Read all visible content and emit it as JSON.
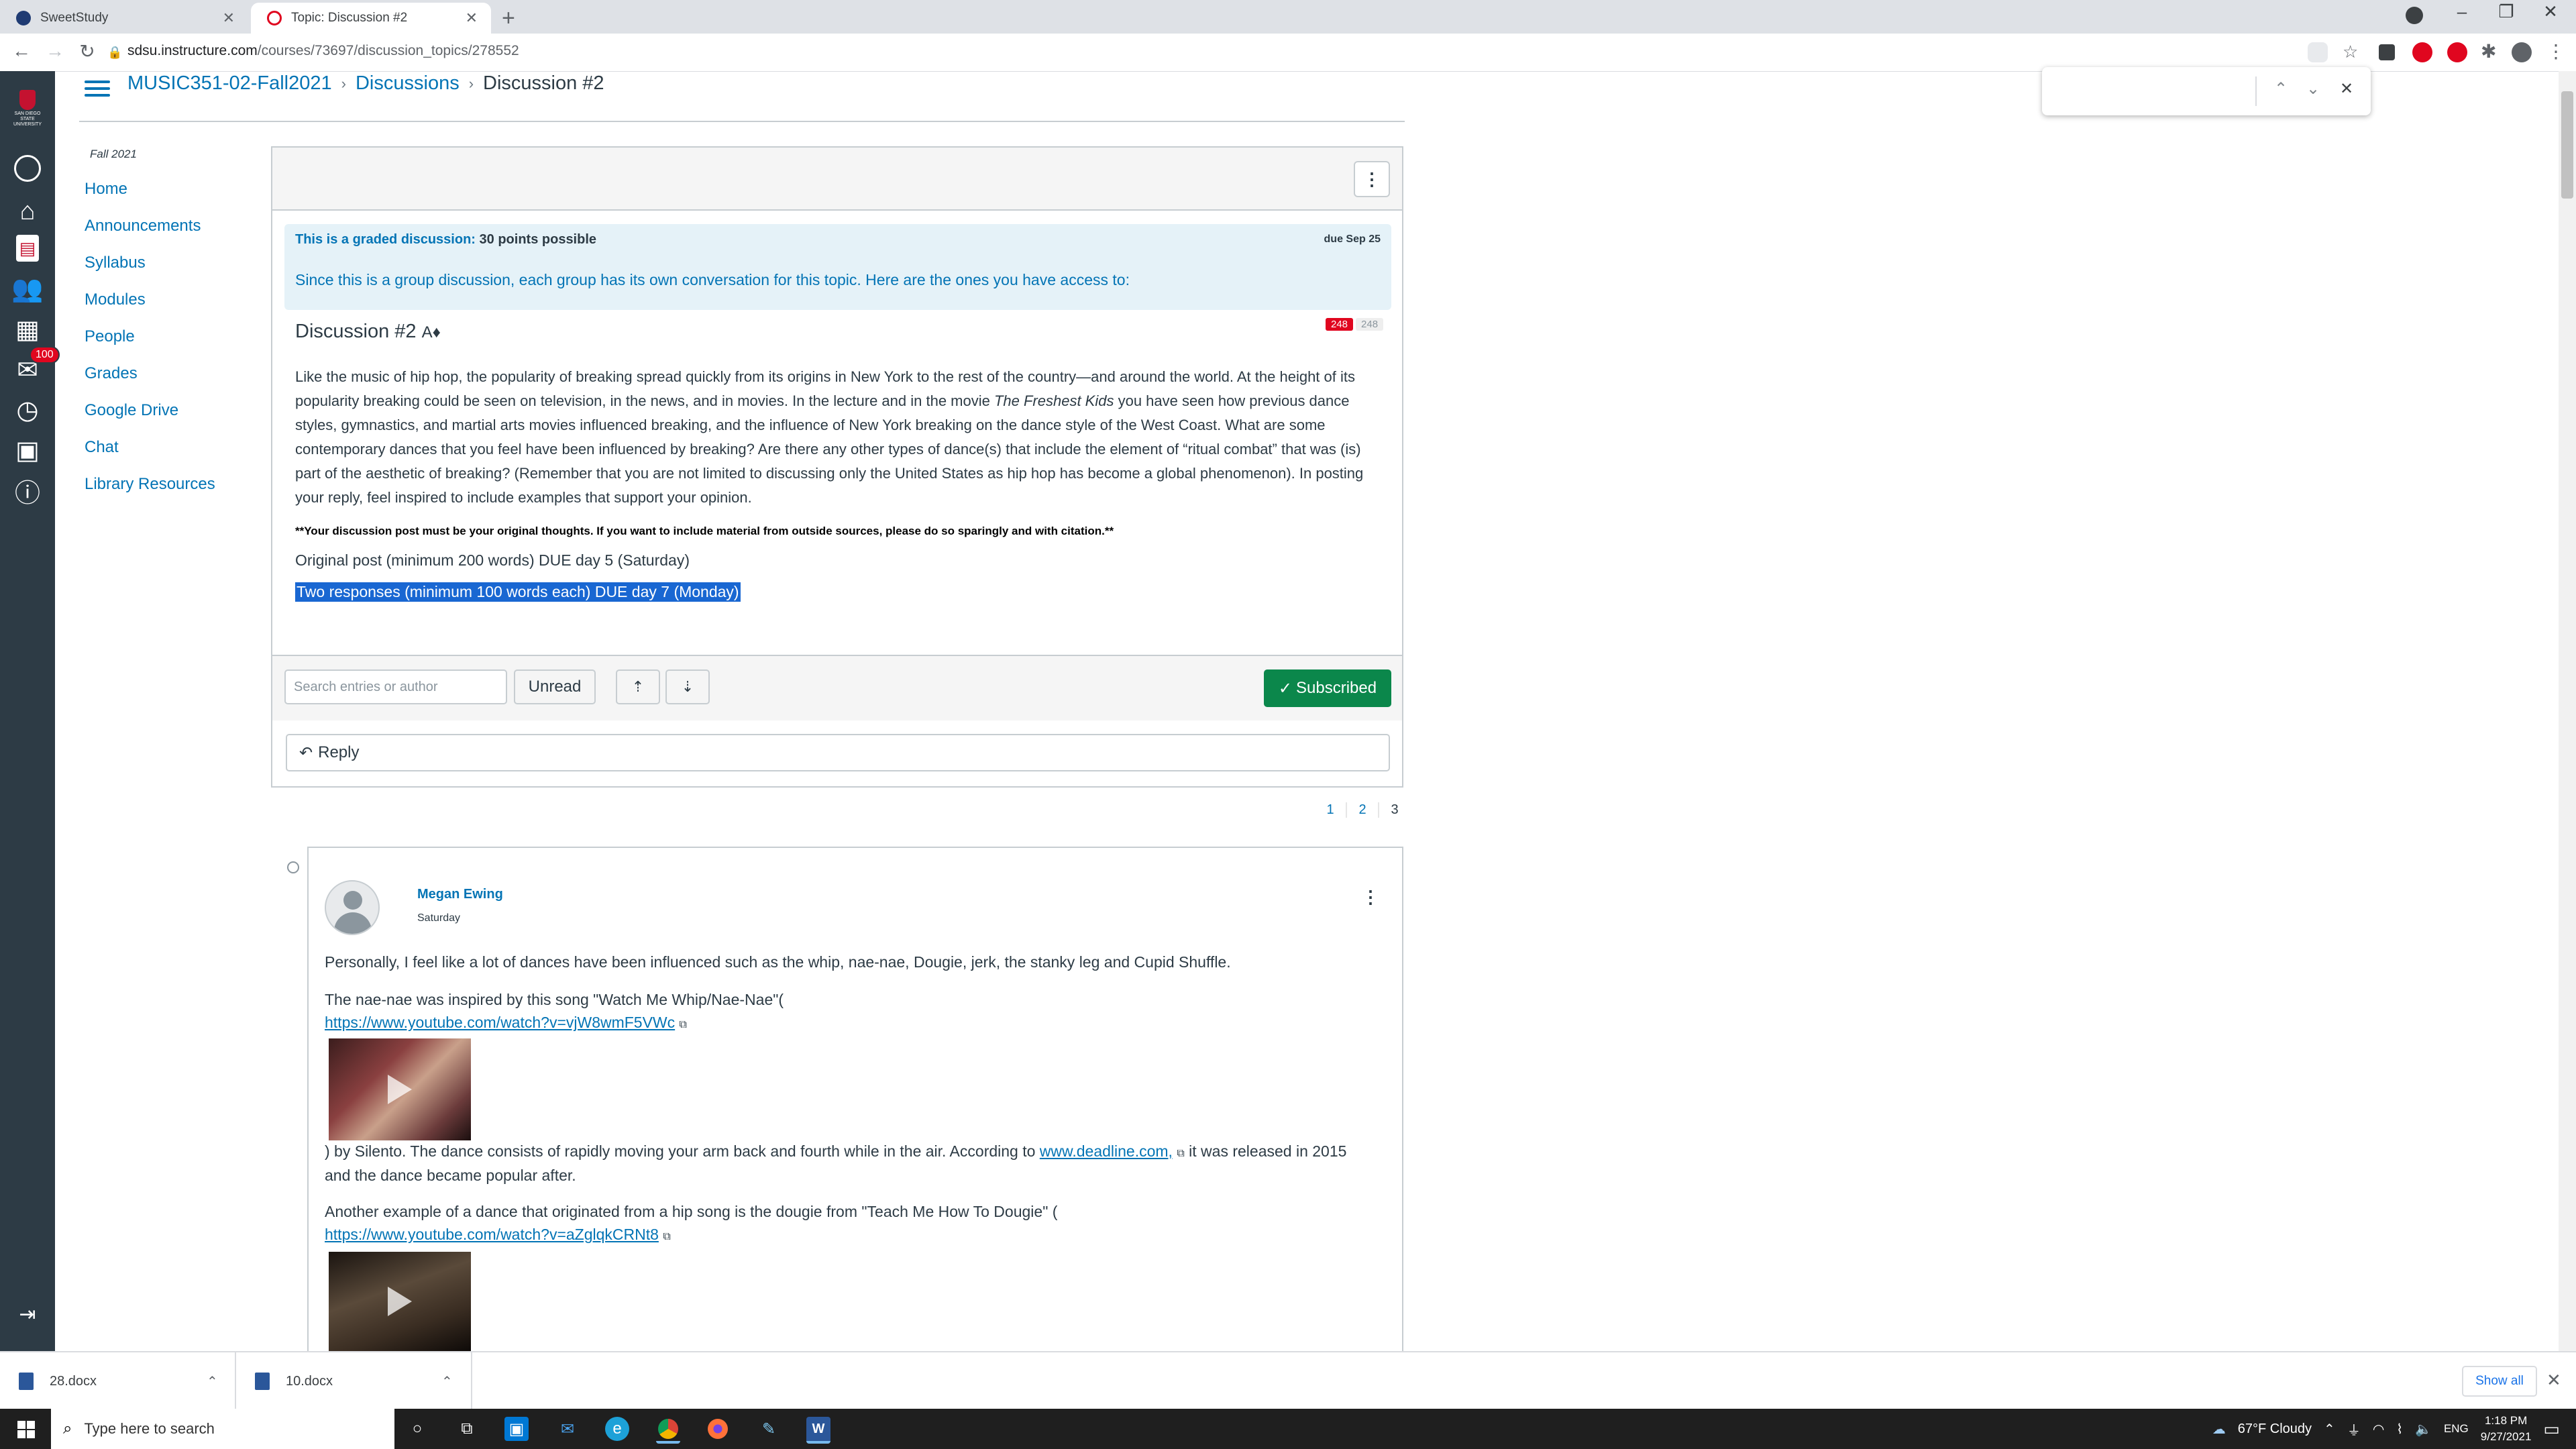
{
  "browser": {
    "tabs": [
      {
        "title": "SweetStudy",
        "active": false
      },
      {
        "title": "Topic: Discussion #2",
        "active": true
      }
    ],
    "url_host": "sdsu.instructure.com",
    "url_path": "/courses/73697/discussion_topics/278552"
  },
  "global_nav": {
    "institution": "SAN DIEGO STATE UNIVERSITY",
    "inbox_badge": "100"
  },
  "breadcrumb": {
    "course": "MUSIC351-02-Fall2021",
    "section": "Discussions",
    "current": "Discussion #2"
  },
  "course_nav": {
    "term": "Fall 2021",
    "items": [
      "Home",
      "Announcements",
      "Syllabus",
      "Modules",
      "People",
      "Grades",
      "Google Drive",
      "Chat",
      "Library Resources"
    ]
  },
  "discussion": {
    "graded_label": "This is a graded discussion:",
    "points": "30 points possible",
    "due": "due Sep 25",
    "group_message": "Since this is a group discussion, each group has its own conversation for this topic. Here are the ones you have access to:",
    "title": "Discussion #2",
    "unread_count": "248",
    "total_count": "248",
    "body_1": "Like the music of hip hop, the popularity of breaking spread quickly from its origins in New York to the rest of the country—and around the world. At the height of its popularity breaking could be seen on television, in the news, and in movies. In the lecture and in the movie ",
    "body_movie": "The Freshest Kids",
    "body_2": " you have seen how previous dance styles, gymnastics, and martial arts movies influenced breaking, and the influence of New York breaking on the dance style of the West Coast. What are some contemporary dances that you feel have been influenced by breaking? Are there any other types of dance(s) that include the element of “ritual combat” that was (is) part of the aesthetic of breaking? (Remember that you are not limited to discussing only the United States as hip hop has become a global phenomenon). In posting your reply, feel inspired to include examples that support your opinion.",
    "note": "**Your discussion post must be your original thoughts. If you want to include material from outside sources, please do so sparingly and with citation.**",
    "original_post": "Original post (minimum 200 words) DUE day 5 (Saturday)",
    "responses": "Two responses (minimum 100 words each) DUE day 7 (Monday)"
  },
  "toolbar": {
    "search_placeholder": "Search entries or author",
    "unread_label": "Unread",
    "subscribed_label": "Subscribed",
    "reply_label": "Reply"
  },
  "pagination": [
    "1",
    "2",
    "3"
  ],
  "entry": {
    "author": "Megan Ewing",
    "posted": "Saturday",
    "p1": "Personally, I feel like a lot of dances have been influenced such as the whip, nae-nae, Dougie, jerk, the stanky leg and Cupid Shuffle.",
    "p2": "The nae-nae was inspired by this song \"Watch Me Whip/Nae-Nae\"(",
    "link1": "https://www.youtube.com/watch?v=vjW8wmF5VWc",
    "p3a": ") by Silento. The dance consists of rapidly moving your arm back and fourth while in the air. According to ",
    "link2": "www.deadline.com,",
    "p3b": " it was released in 2015",
    "p3c": "and the dance became popular after.",
    "p4": "Another example of a dance that originated from a hip song is the dougie from \"Teach Me How To Dougie\" (",
    "link3": "https://www.youtube.com/watch?v=aZglqkCRNt8"
  },
  "downloads": {
    "files": [
      "28.docx",
      "10.docx"
    ],
    "show_all": "Show all"
  },
  "taskbar": {
    "search_placeholder": "Type here to search",
    "weather": "67°F  Cloudy",
    "lang": "ENG",
    "time": "1:18 PM",
    "date": "9/27/2021"
  }
}
